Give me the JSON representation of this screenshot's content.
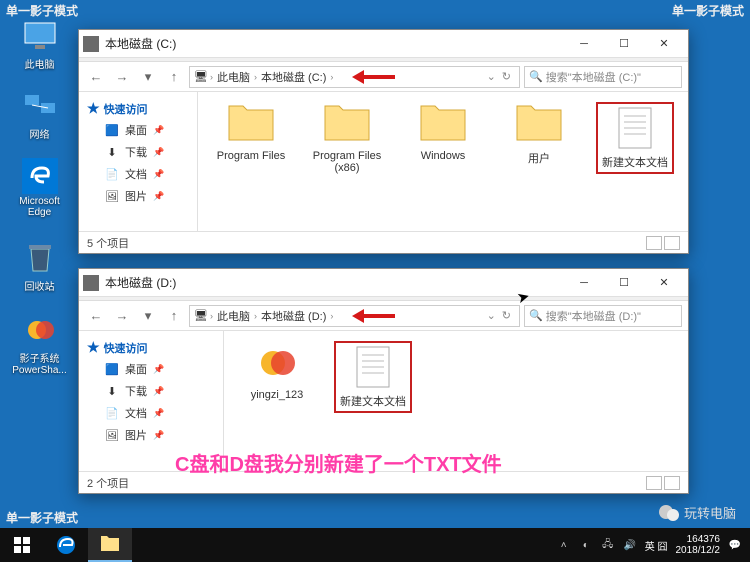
{
  "watermarks": {
    "top_left": "单一影子模式",
    "top_right": "单一影子模式",
    "bottom_left": "单一影子模式"
  },
  "desktop": {
    "this_pc": "此电脑",
    "network": "网络",
    "edge": "Microsoft Edge",
    "recycle": "回收站",
    "shadow": "影子系统 PowerSha..."
  },
  "win_c": {
    "title": "本地磁盘 (C:)",
    "breadcrumb": {
      "pc": "此电脑",
      "drive": "本地磁盘 (C:)"
    },
    "search_placeholder": "搜索\"本地磁盘 (C:)\"",
    "sidebar": {
      "quick": "快速访问",
      "desktop": "桌面",
      "downloads": "下载",
      "documents": "文档",
      "pictures": "图片"
    },
    "items": {
      "program_files": "Program Files",
      "program_files_x86": "Program Files (x86)",
      "windows": "Windows",
      "users": "用户",
      "new_txt": "新建文本文档"
    },
    "status": "5 个项目"
  },
  "win_d": {
    "title": "本地磁盘 (D:)",
    "breadcrumb": {
      "pc": "此电脑",
      "drive": "本地磁盘 (D:)"
    },
    "search_placeholder": "搜索\"本地磁盘 (D:)\"",
    "sidebar": {
      "quick": "快速访问",
      "desktop": "桌面",
      "downloads": "下载",
      "documents": "文档",
      "pictures": "图片"
    },
    "items": {
      "yingzi": "yingzi_123",
      "new_txt": "新建文本文档"
    },
    "status": "2 个项目"
  },
  "annotation": "C盘和D盘我分别新建了一个TXT文件",
  "wechat": "玩转电脑",
  "taskbar": {
    "tray_text": "英 囧",
    "id": "164376",
    "date": "2018/12/2"
  }
}
